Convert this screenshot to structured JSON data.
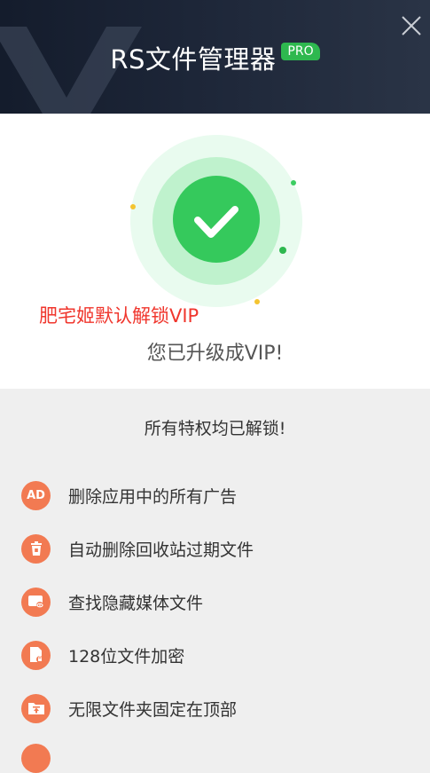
{
  "header": {
    "title": "RS文件管理器",
    "badge": "PRO",
    "close_icon": "close-icon"
  },
  "status": {
    "overlay_text": "肥宅姬默认解锁VIP",
    "message": "您已升级成VIP!"
  },
  "benefits": {
    "heading": "所有特权均已解锁!",
    "items": [
      {
        "icon": "ad-icon",
        "icon_text": "AD",
        "label": "删除应用中的所有广告"
      },
      {
        "icon": "trash-icon",
        "label": "自动删除回收站过期文件"
      },
      {
        "icon": "hidden-media-icon",
        "label": "查找隐藏媒体文件"
      },
      {
        "icon": "lock-file-icon",
        "label": "128位文件加密"
      },
      {
        "icon": "pin-folder-icon",
        "label": "无限文件夹固定在顶部"
      }
    ]
  },
  "colors": {
    "header_bg": "#1d2638",
    "pro_green": "#2eb84f",
    "check_green": "#35c95c",
    "overlay_red": "#f0362d",
    "benefit_orange": "#f27a52"
  }
}
